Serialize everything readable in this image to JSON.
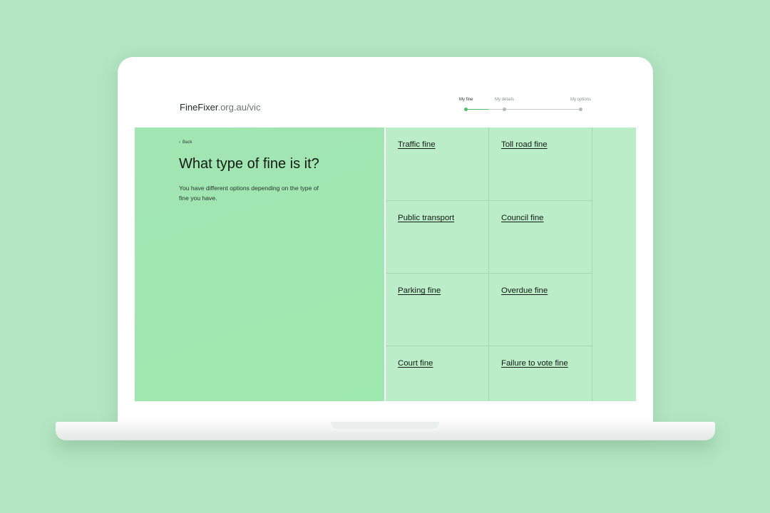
{
  "header": {
    "brand_name": "FineFixer",
    "brand_domain": ".org.au/vic"
  },
  "progress": {
    "steps": [
      {
        "label": "My fine",
        "active": true
      },
      {
        "label": "My details",
        "active": false
      },
      {
        "label": "My options",
        "active": false
      }
    ],
    "completion": 0.2
  },
  "main": {
    "back_label": "Back",
    "title": "What type of fine is it?",
    "description": "You have different options depending on the type of fine you have."
  },
  "fine_types": [
    "Traffic fine",
    "Toll road fine",
    "Public transport",
    "Council fine",
    "Parking fine",
    "Overdue fine",
    "Court fine",
    "Failure to vote fine"
  ],
  "colors": {
    "background": "#b3e5c2",
    "left_panel": "#9de8af",
    "grid_panel": "#bbedc9",
    "accent": "#4fbf6e"
  }
}
